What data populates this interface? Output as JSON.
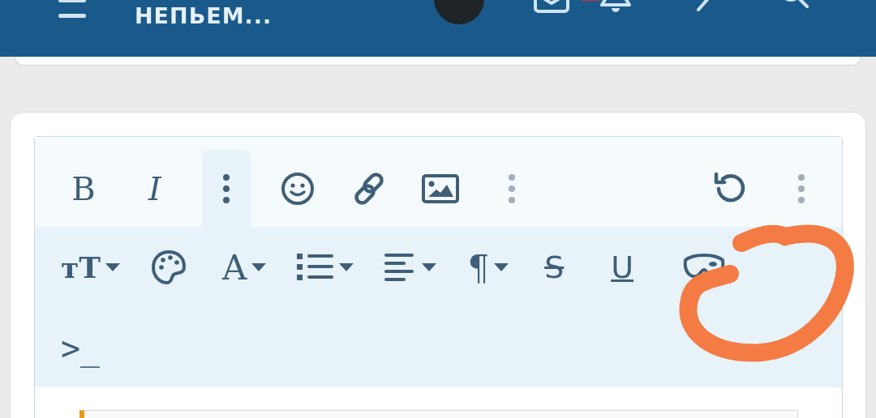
{
  "header": {
    "title": "НЕПЬЕМ...",
    "notification_badge": true
  },
  "toolbar_main": [
    {
      "kind": "bold",
      "label": "B",
      "selected": false
    },
    {
      "kind": "italic",
      "label": "I",
      "selected": false
    },
    {
      "kind": "more",
      "selected": true
    },
    {
      "kind": "emoji",
      "selected": false
    },
    {
      "kind": "link",
      "selected": false
    },
    {
      "kind": "image",
      "selected": false
    },
    {
      "kind": "more-muted",
      "selected": false
    },
    {
      "kind": "undo",
      "selected": false
    },
    {
      "kind": "more-muted",
      "selected": false
    }
  ],
  "toolbar_more": [
    {
      "kind": "size",
      "label": "ᴛT",
      "dropdown": true
    },
    {
      "kind": "palette",
      "dropdown": false
    },
    {
      "kind": "letter",
      "label": "A",
      "dropdown": true
    },
    {
      "kind": "list",
      "dropdown": true
    },
    {
      "kind": "align",
      "dropdown": true
    },
    {
      "kind": "letter",
      "label": "¶",
      "dropdown": true
    },
    {
      "kind": "strike",
      "label": "S",
      "dropdown": false
    },
    {
      "kind": "underline",
      "label": "U",
      "dropdown": false
    },
    {
      "kind": "mask",
      "dropdown": false
    },
    {
      "kind": "code",
      "label": ">_",
      "dropdown": false
    }
  ]
}
